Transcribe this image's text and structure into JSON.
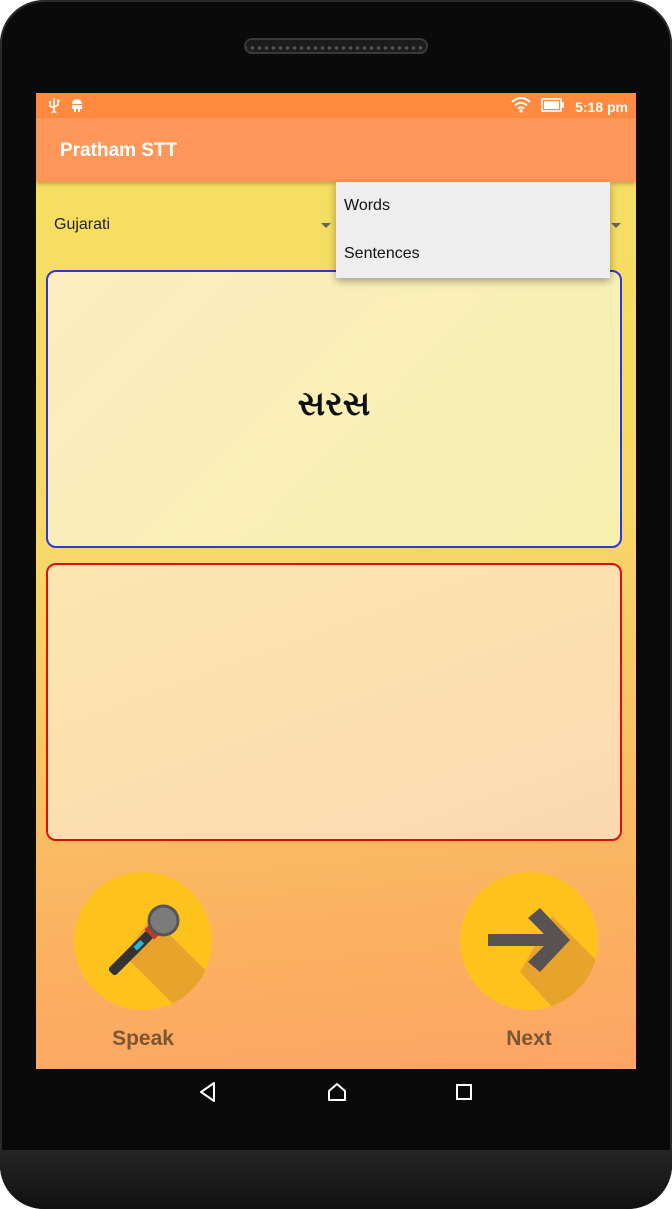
{
  "status_bar": {
    "time": "5:18 pm",
    "left_icons": [
      "usb-icon",
      "android-debug-icon"
    ],
    "right_icons": [
      "wifi-icon",
      "battery-icon"
    ]
  },
  "app_bar": {
    "title": "Pratham STT"
  },
  "language_spinner": {
    "selected": "Gujarati"
  },
  "mode_spinner": {
    "options": [
      "Words",
      "Sentences"
    ]
  },
  "prompt_card": {
    "text": "સરસ",
    "border_color": "#2f37d6"
  },
  "result_card": {
    "text": "",
    "border_color": "#e00d0d"
  },
  "speak_button": {
    "label": "Speak",
    "icon": "microphone-icon"
  },
  "next_button": {
    "label": "Next",
    "icon": "arrow-right-icon"
  },
  "nav_bar": {
    "buttons": [
      "back-icon",
      "home-icon",
      "recents-icon"
    ]
  },
  "colors": {
    "status_bar": "#ff8a40",
    "app_bar": "#fe975a",
    "fab": "#fdc31c",
    "label": "#7a5632"
  }
}
